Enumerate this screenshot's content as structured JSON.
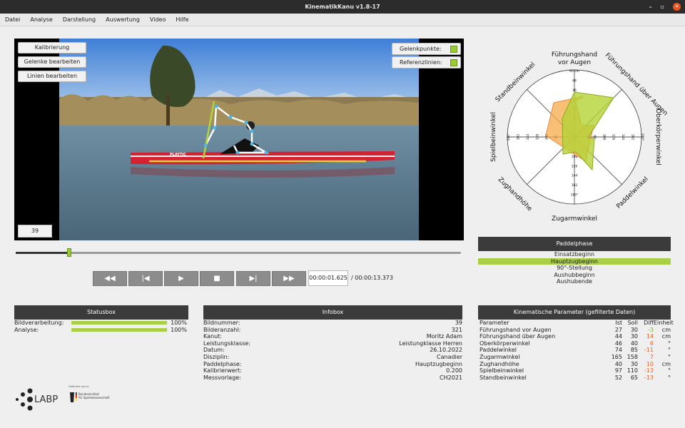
{
  "window": {
    "title": "KinematikKanu v1.8-17",
    "controls": [
      "–",
      "▫",
      "✕"
    ]
  },
  "menu": [
    "Datei",
    "Analyse",
    "Darstellung",
    "Auswertung",
    "Video",
    "Hilfe"
  ],
  "video": {
    "buttons": {
      "calibrate": "Kalibrierung",
      "edit_joints": "Gelenke bearbeiten",
      "edit_lines": "Linien bearbeiten"
    },
    "toggles": {
      "joints": "Gelenkpunkte:",
      "reference": "Referenzlinien:"
    },
    "frame": "39",
    "boat_text": "PLAYTIC"
  },
  "playback": {
    "progress": 0.12,
    "buttons": [
      "◀◀",
      "|◀",
      "▶",
      "■",
      "▶|",
      "▶▶"
    ],
    "current_time": "00:00:01.625",
    "total_time": "/ 00:00:13.373"
  },
  "radar": {
    "axes": [
      "Führungshand vor Augen",
      "Führungshand über Augen",
      "Oberkörperwinkel",
      "Paddelwinkel",
      "Zugarmwinkel",
      "Zughandhöhe",
      "Spielbeinwinkel",
      "Standbeinwinkel"
    ],
    "ticks_top": [
      "60 cm",
      "48",
      "36",
      "24",
      "12",
      "0"
    ],
    "ticks_bottom": [
      "108",
      "126",
      "144",
      "162",
      "180°"
    ],
    "ticks_left": [
      "180°",
      "162",
      "144",
      "126",
      "108",
      "90"
    ],
    "ticks_right": [
      "90",
      "108",
      "126",
      "144",
      "162",
      "180°"
    ],
    "ticks_diag": [
      "105°",
      "105°",
      "150°",
      "150°",
      "135°"
    ],
    "colors": {
      "soll": "#f5a94a",
      "ist": "#b5d335"
    }
  },
  "phase": {
    "title": "Paddelphase",
    "items": [
      "Einsatzbeginn",
      "Hauptzugbeginn",
      "90°-Stellung",
      "Aushubbeginn",
      "Aushubende"
    ],
    "active_index": 1
  },
  "statusbox": {
    "title": "Statusbox",
    "rows": [
      {
        "label": "Bildverarbeitung:",
        "value": "100%",
        "fraction": 1.0
      },
      {
        "label": "Analyse:",
        "value": "100%",
        "fraction": 1.0
      }
    ]
  },
  "infobox": {
    "title": "Infobox",
    "rows": [
      {
        "label": "Bildnummer:",
        "value": "39"
      },
      {
        "label": "Bilderanzahl:",
        "value": "321"
      },
      {
        "label": "Kanut:",
        "value": "Moritz Adam"
      },
      {
        "label": "Leistungsklasse:",
        "value": "Leistungklasse Herren"
      },
      {
        "label": "Datum:",
        "value": "26.10.2022"
      },
      {
        "label": "Disziplin:",
        "value": "Canadier"
      },
      {
        "label": "Paddelphase:",
        "value": "Hauptzugbeginn"
      },
      {
        "label": "Kalibrierwert:",
        "value": "0.200"
      },
      {
        "label": "Messvorlage:",
        "value": "CH2021"
      }
    ]
  },
  "params": {
    "title": "Kinematische Parameter (gefilterte Daten)",
    "headers": [
      "Parameter",
      "Ist",
      "Soll",
      "Diff",
      "Einheit"
    ],
    "rows": [
      {
        "name": "Führungshand vor Augen",
        "ist": "27",
        "soll": "30",
        "diff": "-3",
        "unit": "cm",
        "diff_color": "pos"
      },
      {
        "name": "Führungshand über Augen",
        "ist": "44",
        "soll": "30",
        "diff": "14",
        "unit": "cm",
        "diff_color": "neg"
      },
      {
        "name": "Oberkörperwinkel",
        "ist": "46",
        "soll": "40",
        "diff": "6",
        "unit": "°",
        "diff_color": "neg"
      },
      {
        "name": "Paddelwinkel",
        "ist": "74",
        "soll": "85",
        "diff": "-11",
        "unit": "°",
        "diff_color": "neg"
      },
      {
        "name": "Zugarmwinkel",
        "ist": "165",
        "soll": "158",
        "diff": "7",
        "unit": "°",
        "diff_color": "neg"
      },
      {
        "name": "Zughandhöhe",
        "ist": "40",
        "soll": "30",
        "diff": "10",
        "unit": "cm",
        "diff_color": "neg"
      },
      {
        "name": "Spielbeinwinkel",
        "ist": "97",
        "soll": "110",
        "diff": "-13",
        "unit": "°",
        "diff_color": "neg"
      },
      {
        "name": "Standbeinwinkel",
        "ist": "52",
        "soll": "65",
        "diff": "-13",
        "unit": "°",
        "diff_color": "neg"
      }
    ]
  },
  "logos": {
    "labp": "LABP",
    "funding_note": "Gefördert durch:",
    "bisp_line1": "Bundesinstitut",
    "bisp_line2": "für Sportwissenschaft"
  }
}
